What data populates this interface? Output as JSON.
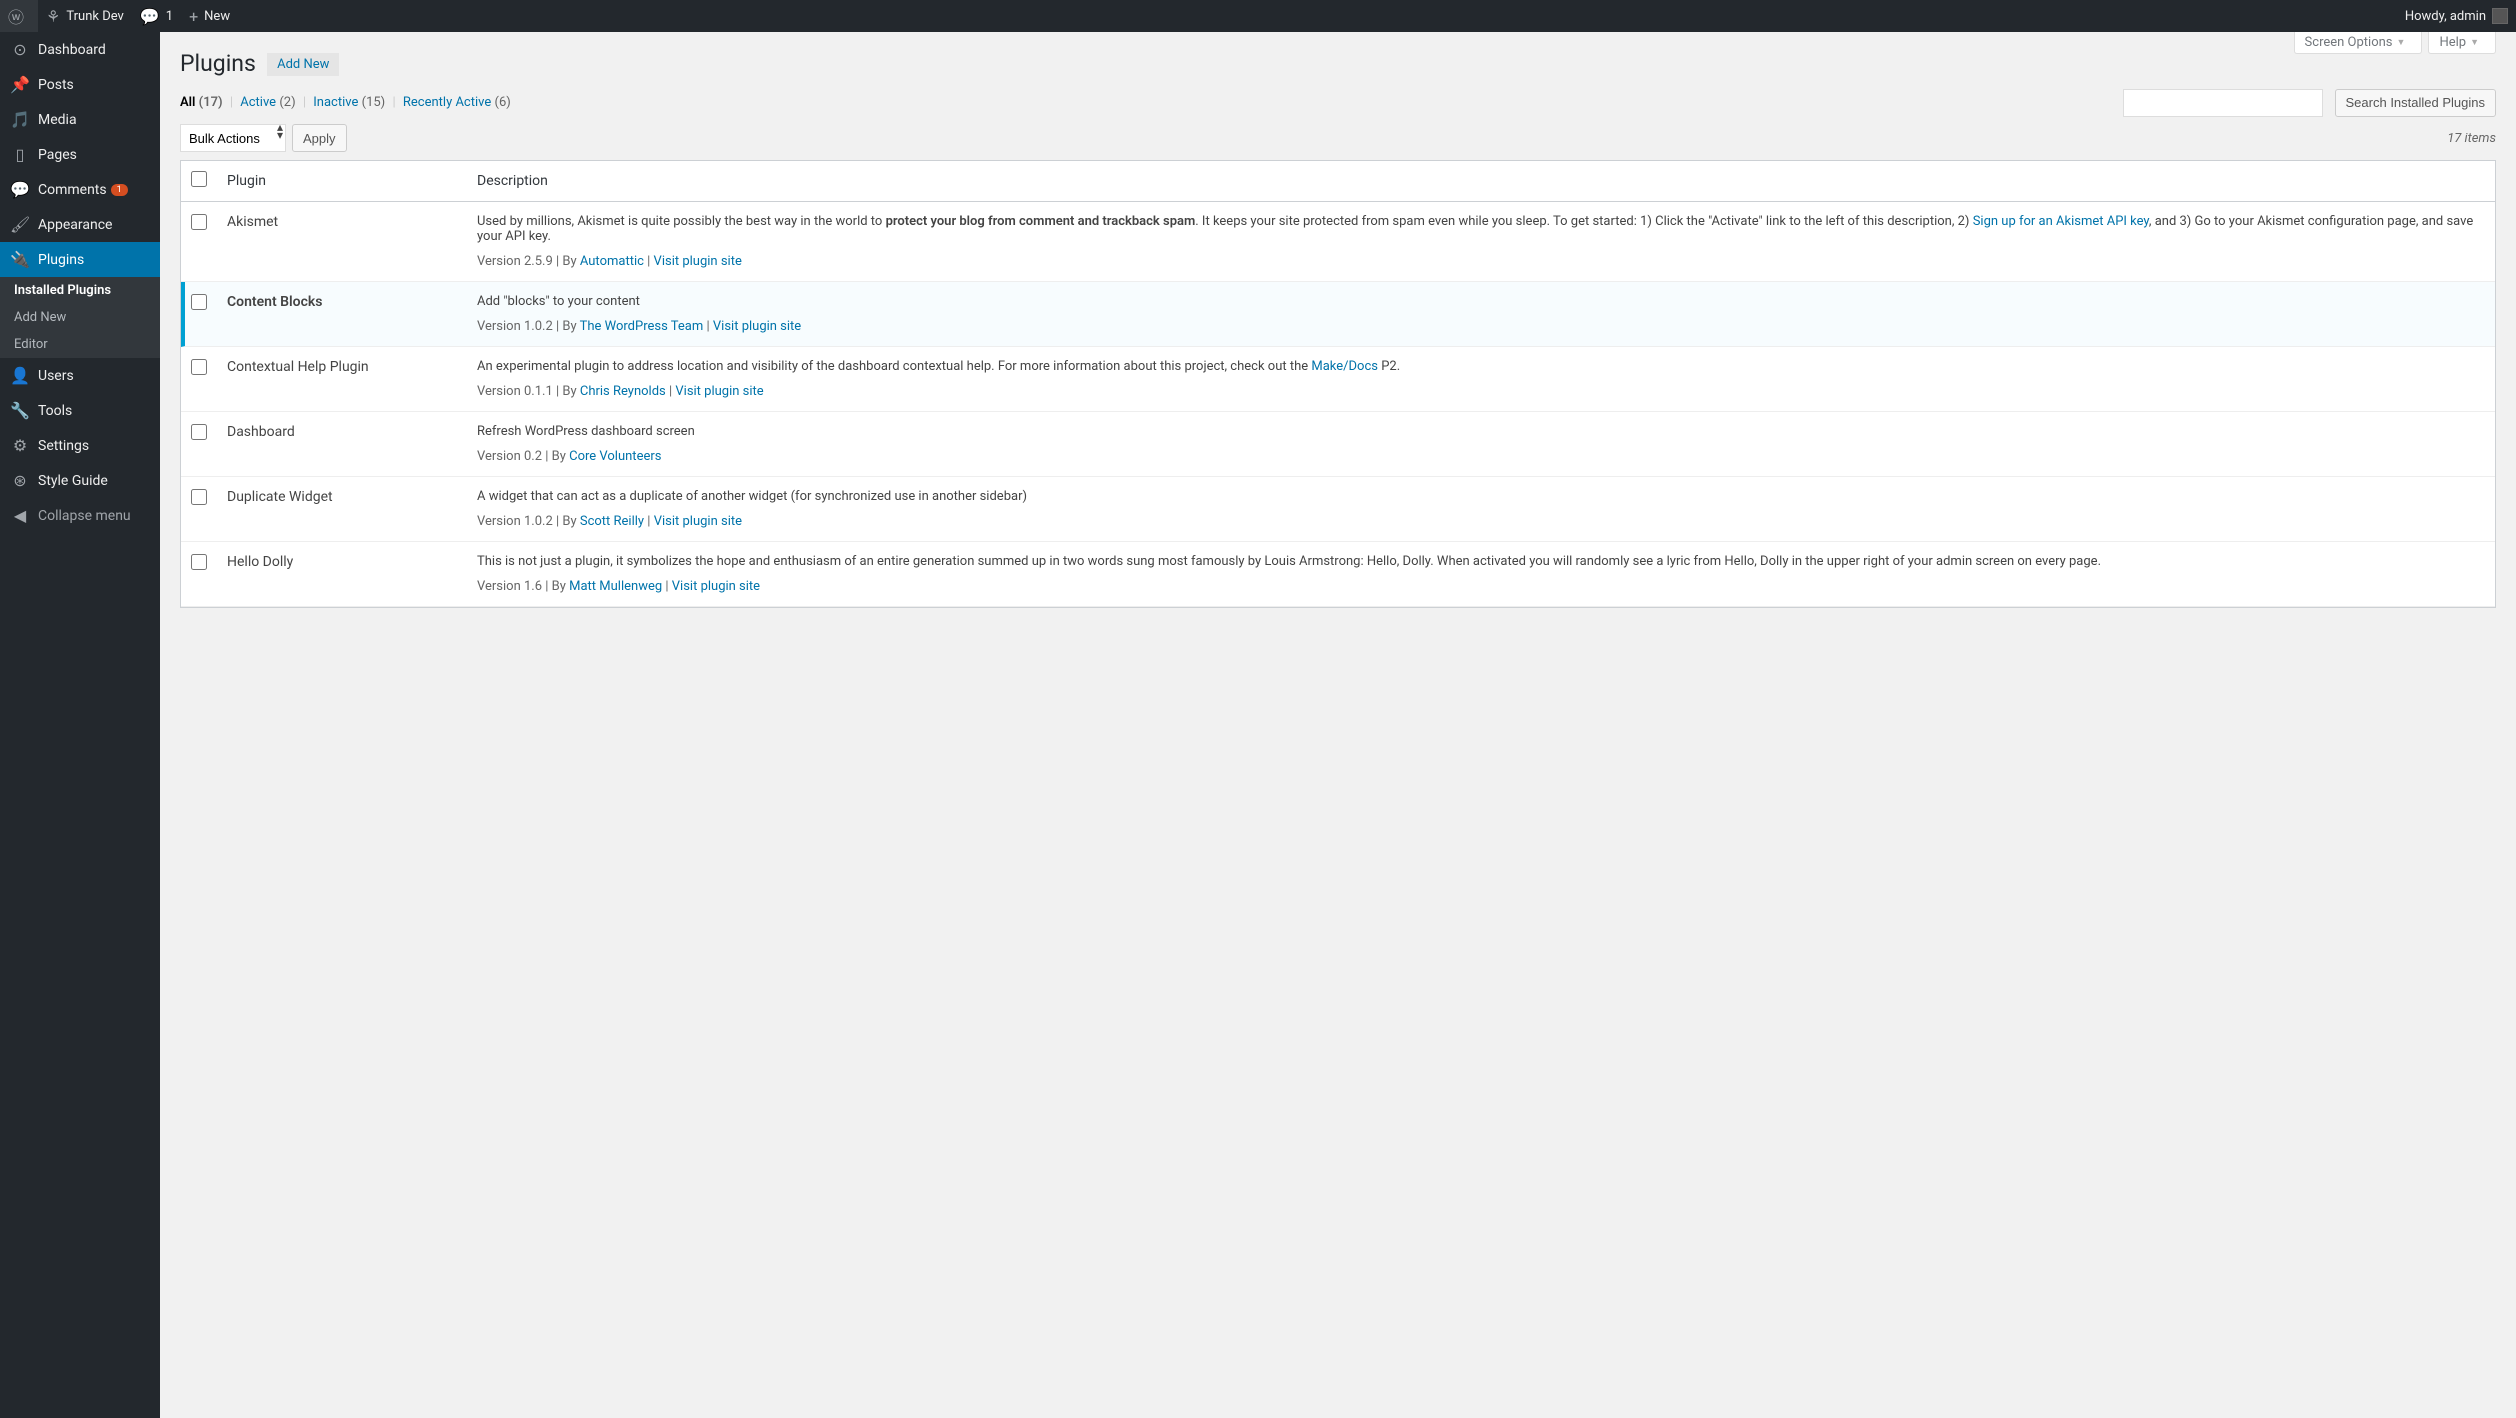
{
  "adminbar": {
    "site_name": "Trunk Dev",
    "comments_count": "1",
    "new_label": "New",
    "howdy": "Howdy, admin"
  },
  "sidebar": {
    "items": [
      {
        "label": "Dashboard"
      },
      {
        "label": "Posts"
      },
      {
        "label": "Media"
      },
      {
        "label": "Pages"
      },
      {
        "label": "Comments",
        "badge": "1"
      },
      {
        "label": "Appearance"
      },
      {
        "label": "Plugins"
      },
      {
        "label": "Users"
      },
      {
        "label": "Tools"
      },
      {
        "label": "Settings"
      },
      {
        "label": "Style Guide"
      }
    ],
    "submenu": [
      {
        "label": "Installed Plugins"
      },
      {
        "label": "Add New"
      },
      {
        "label": "Editor"
      }
    ],
    "collapse": "Collapse menu"
  },
  "screen_meta": {
    "screen_options": "Screen Options",
    "help": "Help"
  },
  "header": {
    "title": "Plugins",
    "add_new": "Add New"
  },
  "filters": {
    "all_label": "All",
    "all_count": "(17)",
    "active_label": "Active",
    "active_count": "(2)",
    "inactive_label": "Inactive",
    "inactive_count": "(15)",
    "recent_label": "Recently Active",
    "recent_count": "(6)"
  },
  "bulk": {
    "label": "Bulk Actions",
    "apply": "Apply"
  },
  "search": {
    "button": "Search Installed Plugins"
  },
  "items_count": "17 items",
  "table": {
    "col_plugin": "Plugin",
    "col_desc": "Description"
  },
  "plugins": [
    {
      "name": "Akismet",
      "active": false,
      "desc_pre": "Used by millions, Akismet is quite possibly the best way in the world to ",
      "desc_bold": "protect your blog from comment and trackback spam",
      "desc_post": ". It keeps your site protected from spam even while you sleep. To get started: 1) Click the \"Activate\" link to the left of this description, 2) ",
      "desc_link": "Sign up for an Akismet API key",
      "desc_tail": ", and 3) Go to your Akismet configuration page, and save your API key.",
      "version": "Version 2.5.9",
      "by": "By ",
      "author": "Automattic",
      "visit": "Visit plugin site"
    },
    {
      "name": "Content Blocks",
      "active": true,
      "desc_pre": "Add \"blocks\" to your content",
      "version": "Version 1.0.2",
      "by": "By ",
      "author": "The WordPress Team",
      "visit": "Visit plugin site"
    },
    {
      "name": "Contextual Help Plugin",
      "active": false,
      "desc_pre": "An experimental plugin to address location and visibility of the dashboard contextual help. For more information about this project, check out the ",
      "desc_link": "Make/Docs",
      "desc_tail": " P2.",
      "version": "Version 0.1.1",
      "by": "By ",
      "author": "Chris Reynolds",
      "visit": "Visit plugin site"
    },
    {
      "name": "Dashboard",
      "active": false,
      "desc_pre": "Refresh WordPress dashboard screen",
      "version": "Version 0.2",
      "by": "By ",
      "author": "Core Volunteers"
    },
    {
      "name": "Duplicate Widget",
      "active": false,
      "desc_pre": "A widget that can act as a duplicate of another widget (for synchronized use in another sidebar)",
      "version": "Version 1.0.2",
      "by": "By ",
      "author": "Scott Reilly",
      "visit": "Visit plugin site"
    },
    {
      "name": "Hello Dolly",
      "active": false,
      "desc_pre": "This is not just a plugin, it symbolizes the hope and enthusiasm of an entire generation summed up in two words sung most famously by Louis Armstrong: Hello, Dolly. When activated you will randomly see a lyric from Hello, Dolly in the upper right of your admin screen on every page.",
      "version": "Version 1.6",
      "by": "By ",
      "author": "Matt Mullenweg",
      "visit": "Visit plugin site"
    }
  ]
}
